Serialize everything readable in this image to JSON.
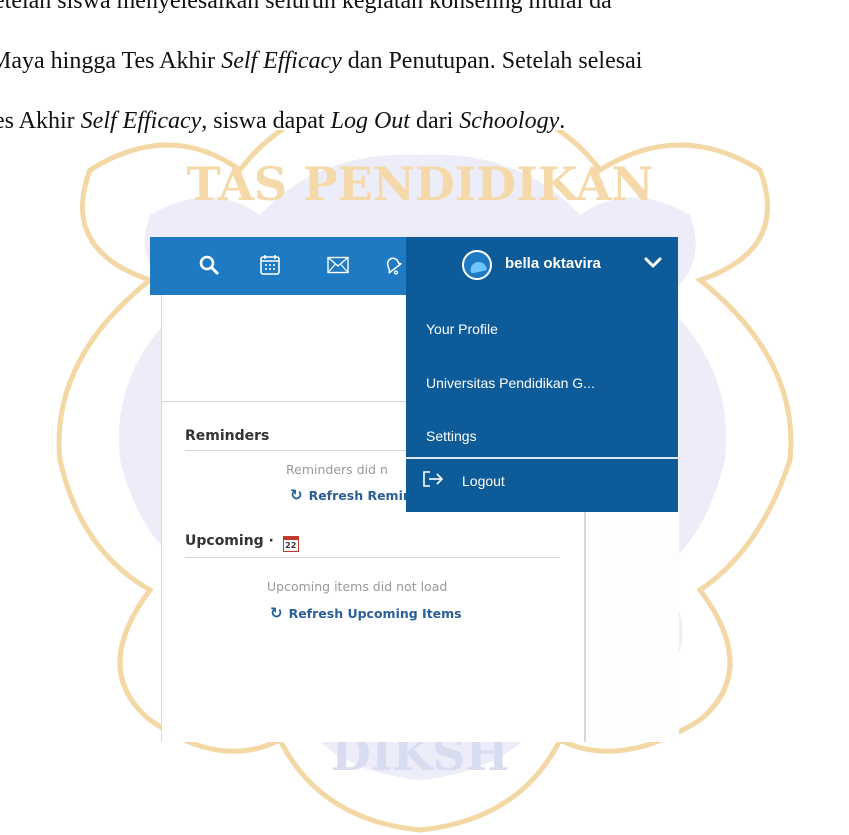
{
  "document": {
    "line1": "etelah siswa menyelesaikan seluruh kegiatan konseling mulai da",
    "line2_a": "Maya hingga Tes Akhir ",
    "line2_em": "Self Efficacy",
    "line2_b": " dan Penutupan. Setelah selesai",
    "line3_a": "es Akhir ",
    "line3_em1": "Self Efficacy",
    "line3_b": ", siswa dapat ",
    "line3_em2": "Log Out",
    "line3_c": " dari ",
    "line3_em3": "Schoology",
    "line3_d": "."
  },
  "watermark": {
    "text_top": "TAS PENDIDIKAN",
    "text_bottom": "DIKSH",
    "color": "#f5d9a8",
    "seal_color": "#dfe0f1"
  },
  "topbar": {
    "color": "#1f7ac4",
    "icons": [
      "search-icon",
      "calendar-icon",
      "mail-icon",
      "bell-icon"
    ],
    "user_name": "bella oktavira"
  },
  "dropdown": {
    "color": "#0e5b99",
    "items": [
      "Your Profile",
      "Universitas Pendidikan G...",
      "Settings"
    ],
    "logout_label": "Logout"
  },
  "reminders": {
    "title": "Reminders",
    "status": "Reminders did n",
    "refresh": "Refresh Reminders"
  },
  "upcoming": {
    "title": "Upcoming · ",
    "calendar_day": "22",
    "status": "Upcoming items did not load",
    "refresh": "Refresh Upcoming Items"
  }
}
